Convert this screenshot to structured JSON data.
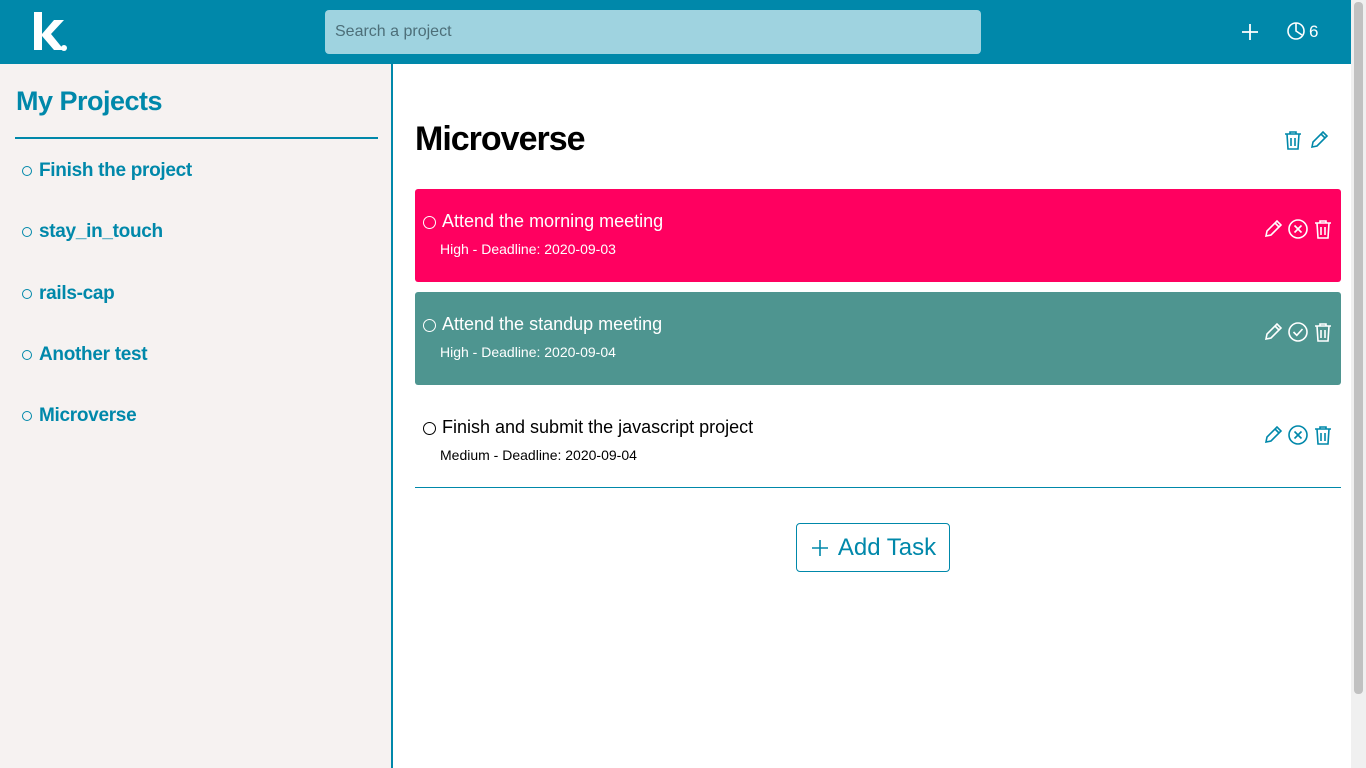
{
  "header": {
    "search_placeholder": "Search a project",
    "count": "6"
  },
  "sidebar": {
    "title": "My Projects",
    "projects": [
      {
        "label": "Finish the project"
      },
      {
        "label": "stay_in_touch"
      },
      {
        "label": "rails-cap"
      },
      {
        "label": "Another test"
      },
      {
        "label": "Microverse"
      }
    ]
  },
  "main": {
    "project_title": "Microverse",
    "tasks": [
      {
        "title": "Attend the morning meeting",
        "meta": "High - Deadline: 2020-09-03"
      },
      {
        "title": "Attend the standup meeting",
        "meta": "High - Deadline: 2020-09-04"
      },
      {
        "title": "Finish and submit the javascript project",
        "meta": "Medium - Deadline: 2020-09-04"
      }
    ],
    "add_task_label": "Add Task"
  },
  "colors": {
    "brand": "#0088aa",
    "high": "#ff0060",
    "completed": "#4e9590",
    "sidebar_bg": "#f6f2f1"
  }
}
